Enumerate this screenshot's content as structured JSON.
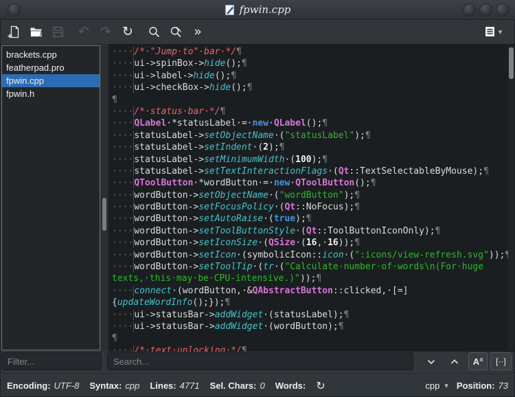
{
  "window": {
    "title": "fpwin.cpp"
  },
  "toolbar": {
    "buttons": [
      "new-file",
      "open-file",
      "save",
      "undo",
      "redo",
      "reload",
      "search",
      "find-and-replace",
      "more",
      "menu"
    ]
  },
  "icons": {
    "undo": "↶",
    "redo": "↷",
    "reload": "↻",
    "more": "»",
    "menu_caret": "▾",
    "match_case_main": "A",
    "match_case_sub": "a",
    "whole_word": "[··]",
    "words_refresh": "↻",
    "syntax_caret": "▾"
  },
  "sidebar": {
    "files": [
      "brackets.cpp",
      "featherpad.pro",
      "fpwin.cpp",
      "fpwin.h"
    ],
    "selected": "fpwin.cpp",
    "filter_placeholder": "Filter..."
  },
  "search": {
    "placeholder": "Search..."
  },
  "colors": {
    "selection_blue": "#2d6cb4",
    "editor_bg": "#1b1e20",
    "comment": "#f0636c",
    "string": "#2eb82e",
    "type": "#d874d8",
    "keyword": "#4292e6",
    "member_function": "#43c3cb"
  },
  "editor": {
    "rows": [
      [
        [
          "i",
          "····"
        ],
        [
          "c",
          "/*·\"Jump·to\"·bar·*/"
        ],
        [
          "p",
          "¶"
        ]
      ],
      [
        [
          "i",
          "····"
        ],
        [
          "d",
          "ui->spinBox->"
        ],
        [
          "f",
          "hide"
        ],
        [
          "d",
          "();"
        ],
        [
          "p",
          "¶"
        ]
      ],
      [
        [
          "i",
          "····"
        ],
        [
          "d",
          "ui->label->"
        ],
        [
          "f",
          "hide"
        ],
        [
          "d",
          "();"
        ],
        [
          "p",
          "¶"
        ]
      ],
      [
        [
          "i",
          "····"
        ],
        [
          "d",
          "ui->checkBox->"
        ],
        [
          "f",
          "hide"
        ],
        [
          "d",
          "();"
        ],
        [
          "p",
          "¶"
        ]
      ],
      [
        [
          "p",
          "¶"
        ]
      ],
      [
        [
          "i",
          "····"
        ],
        [
          "c",
          "/*·status·bar·*/"
        ],
        [
          "p",
          "¶"
        ]
      ],
      [
        [
          "i",
          "····"
        ],
        [
          "t",
          "QLabel"
        ],
        [
          "d",
          "·*statusLabel·=·"
        ],
        [
          "k",
          "new"
        ],
        [
          "d",
          "·"
        ],
        [
          "t",
          "QLabel"
        ],
        [
          "d",
          "();"
        ],
        [
          "p",
          "¶"
        ]
      ],
      [
        [
          "i",
          "····"
        ],
        [
          "d",
          "statusLabel->"
        ],
        [
          "f",
          "setObjectName"
        ],
        [
          "d",
          "·("
        ],
        [
          "s",
          "\"statusLabel\""
        ],
        [
          "d",
          ");"
        ],
        [
          "p",
          "¶"
        ]
      ],
      [
        [
          "i",
          "····"
        ],
        [
          "d",
          "statusLabel->"
        ],
        [
          "f",
          "setIndent"
        ],
        [
          "d",
          "·("
        ],
        [
          "n",
          "2"
        ],
        [
          "d",
          ");"
        ],
        [
          "p",
          "¶"
        ]
      ],
      [
        [
          "i",
          "····"
        ],
        [
          "d",
          "statusLabel->"
        ],
        [
          "f",
          "setMinimumWidth"
        ],
        [
          "d",
          "·("
        ],
        [
          "n",
          "100"
        ],
        [
          "d",
          ");"
        ],
        [
          "p",
          "¶"
        ]
      ],
      [
        [
          "i",
          "····"
        ],
        [
          "d",
          "statusLabel->"
        ],
        [
          "f",
          "setTextInteractionFlags"
        ],
        [
          "d",
          "·("
        ],
        [
          "t",
          "Qt"
        ],
        [
          "d",
          "::TextSelectableByMouse);"
        ],
        [
          "p",
          "¶"
        ]
      ],
      [
        [
          "i",
          "····"
        ],
        [
          "t",
          "QToolButton"
        ],
        [
          "d",
          "·*wordButton·=·"
        ],
        [
          "k",
          "new"
        ],
        [
          "d",
          "·"
        ],
        [
          "t",
          "QToolButton"
        ],
        [
          "d",
          "();"
        ],
        [
          "p",
          "¶"
        ]
      ],
      [
        [
          "i",
          "····"
        ],
        [
          "d",
          "wordButton->"
        ],
        [
          "f",
          "setObjectName"
        ],
        [
          "d",
          "·("
        ],
        [
          "s",
          "\"wordButton\""
        ],
        [
          "d",
          ");"
        ],
        [
          "p",
          "¶"
        ]
      ],
      [
        [
          "i",
          "····"
        ],
        [
          "d",
          "wordButton->"
        ],
        [
          "f",
          "setFocusPolicy"
        ],
        [
          "d",
          "·("
        ],
        [
          "t",
          "Qt"
        ],
        [
          "d",
          "::NoFocus);"
        ],
        [
          "p",
          "¶"
        ]
      ],
      [
        [
          "i",
          "····"
        ],
        [
          "d",
          "wordButton->"
        ],
        [
          "f",
          "setAutoRaise"
        ],
        [
          "d",
          "·("
        ],
        [
          "k",
          "true"
        ],
        [
          "d",
          ");"
        ],
        [
          "p",
          "¶"
        ]
      ],
      [
        [
          "i",
          "····"
        ],
        [
          "d",
          "wordButton->"
        ],
        [
          "f",
          "setToolButtonStyle"
        ],
        [
          "d",
          "·("
        ],
        [
          "t",
          "Qt"
        ],
        [
          "d",
          "::ToolButtonIconOnly);"
        ],
        [
          "p",
          "¶"
        ]
      ],
      [
        [
          "i",
          "····"
        ],
        [
          "d",
          "wordButton->"
        ],
        [
          "f",
          "setIconSize"
        ],
        [
          "d",
          "·("
        ],
        [
          "t",
          "QSize"
        ],
        [
          "d",
          "·("
        ],
        [
          "n",
          "16"
        ],
        [
          "d",
          ",·"
        ],
        [
          "n",
          "16"
        ],
        [
          "d",
          "));"
        ],
        [
          "p",
          "¶"
        ]
      ],
      [
        [
          "i",
          "····"
        ],
        [
          "d",
          "wordButton->"
        ],
        [
          "f",
          "setIcon"
        ],
        [
          "d",
          "·(symbolicIcon::"
        ],
        [
          "f",
          "icon"
        ],
        [
          "d",
          "·("
        ],
        [
          "s",
          "\":icons/view-refresh.svg\""
        ],
        [
          "d",
          "));"
        ],
        [
          "p",
          "¶"
        ]
      ],
      [
        [
          "i",
          "····"
        ],
        [
          "d",
          "wordButton->"
        ],
        [
          "f",
          "setToolTip"
        ],
        [
          "d",
          "·("
        ],
        [
          "f",
          "tr"
        ],
        [
          "d",
          "·("
        ],
        [
          "s",
          "\"Calculate·number·of·words\\n(For·huge"
        ]
      ],
      [
        [
          "s",
          "texts,·this·may·be·CPU-intensive.)\""
        ],
        [
          "d",
          "));"
        ],
        [
          "p",
          "¶"
        ]
      ],
      [
        [
          "i",
          "····"
        ],
        [
          "f",
          "connect"
        ],
        [
          "d",
          "·(wordButton,·&"
        ],
        [
          "t",
          "QAbstractButton"
        ],
        [
          "d",
          "::clicked,·[=]"
        ]
      ],
      [
        [
          "d",
          "{"
        ],
        [
          "f",
          "updateWordInfo"
        ],
        [
          "d",
          "();});"
        ],
        [
          "p",
          "¶"
        ]
      ],
      [
        [
          "i",
          "····"
        ],
        [
          "d",
          "ui->statusBar->"
        ],
        [
          "f",
          "addWidget"
        ],
        [
          "d",
          "·(statusLabel);"
        ],
        [
          "p",
          "¶"
        ]
      ],
      [
        [
          "i",
          "····"
        ],
        [
          "d",
          "ui->statusBar->"
        ],
        [
          "f",
          "addWidget"
        ],
        [
          "d",
          "·(wordButton);"
        ],
        [
          "p",
          "¶"
        ]
      ],
      [
        [
          "p",
          "¶"
        ]
      ],
      [
        [
          "i",
          "····"
        ],
        [
          "c",
          "/*·text·unlocking·*/"
        ],
        [
          "p",
          "¶"
        ]
      ]
    ]
  },
  "statusbar": {
    "encoding_label": "Encoding:",
    "encoding_value": "UTF-8",
    "syntax_label": "Syntax:",
    "syntax_value": "cpp",
    "lines_label": "Lines:",
    "lines_value": "4771",
    "sel_chars_label": "Sel. Chars:",
    "sel_chars_value": "0",
    "words_label": "Words:",
    "lang_selector": "cpp",
    "position_label": "Position:",
    "position_value": "73"
  }
}
